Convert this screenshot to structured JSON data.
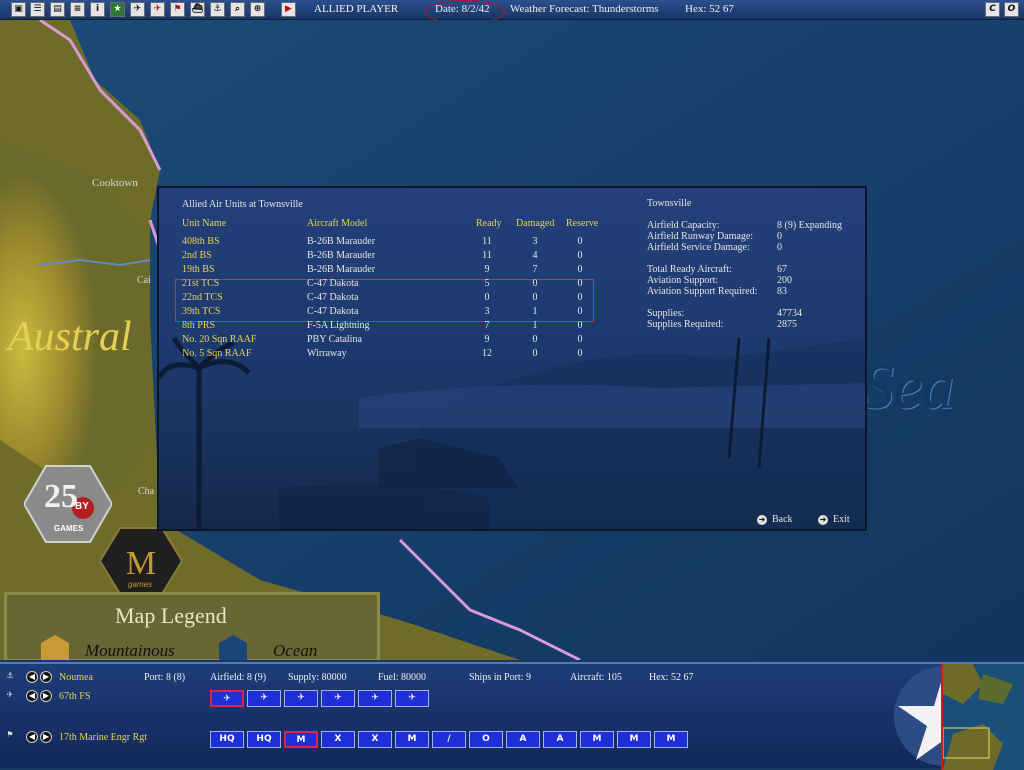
{
  "topbar": {
    "player": "ALLIED PLAYER",
    "date": "Date: 8/2/42",
    "weather": "Weather Forecast: Thunderstorms",
    "hex": "Hex: 52 67",
    "buttons": [
      "save-icon",
      "document-icon",
      "ledger-icon",
      "list-icon",
      "info-icon",
      "star-icon",
      "plane-group-icon",
      "plane-red-icon",
      "flag-icon",
      "ship-icon",
      "ships-icon",
      "magnifier-icon",
      "target-icon",
      "end-turn-icon"
    ],
    "right_buttons": [
      "C",
      "O"
    ]
  },
  "map": {
    "labels": {
      "cooktown": "Cooktown",
      "cairns": "Cai",
      "australia": "Austral",
      "sea": "Sea",
      "charters": "Cha"
    },
    "logos": {
      "by25": "BY",
      "by25_num": "25",
      "games": "GAMES",
      "matrix": "games"
    },
    "legend": {
      "title": "Map Legend",
      "mountainous": "Mountainous",
      "ocean": "Ocean"
    }
  },
  "panel": {
    "title": "Allied Air Units at Townsville",
    "headers": {
      "unit": "Unit Name",
      "model": "Aircraft Model",
      "ready": "Ready",
      "damaged": "Damaged",
      "reserve": "Reserve"
    },
    "rows": [
      {
        "unit": "408th BS",
        "model": "B-26B Marauder",
        "ready": "11",
        "damaged": "3",
        "reserve": "0"
      },
      {
        "unit": "2nd BS",
        "model": "B-26B Marauder",
        "ready": "11",
        "damaged": "4",
        "reserve": "0"
      },
      {
        "unit": "19th BS",
        "model": "B-26B Marauder",
        "ready": "9",
        "damaged": "7",
        "reserve": "0"
      },
      {
        "unit": "21st TCS",
        "model": "C-47 Dakota",
        "ready": "5",
        "damaged": "0",
        "reserve": "0"
      },
      {
        "unit": "22nd TCS",
        "model": "C-47 Dakota",
        "ready": "0",
        "damaged": "0",
        "reserve": "0"
      },
      {
        "unit": "39th TCS",
        "model": "C-47 Dakota",
        "ready": "3",
        "damaged": "1",
        "reserve": "0"
      },
      {
        "unit": "8th PRS",
        "model": "F-5A Lightning",
        "ready": "7",
        "damaged": "1",
        "reserve": "0"
      },
      {
        "unit": "No. 20 Sqn RAAF",
        "model": "PBY Catalina",
        "ready": "9",
        "damaged": "0",
        "reserve": "0"
      },
      {
        "unit": "No. 5 Sqn RAAF",
        "model": "Wirraway",
        "ready": "12",
        "damaged": "0",
        "reserve": "0"
      }
    ],
    "base": {
      "name": "Townsville",
      "stats": [
        {
          "label": "Airfield Capacity:",
          "value": "8 (9) Expanding"
        },
        {
          "label": "Airfield Runway Damage:",
          "value": "0"
        },
        {
          "label": "Airfield Service Damage:",
          "value": "0"
        },
        {
          "label": "Total Ready Aircraft:",
          "value": "67"
        },
        {
          "label": "Aviation Support:",
          "value": "200"
        },
        {
          "label": "Aviation Support Required:",
          "value": "83"
        },
        {
          "label": "Supplies:",
          "value": "47734"
        },
        {
          "label": "Supplies Required:",
          "value": "2875"
        }
      ]
    },
    "back_label": "Back",
    "exit_label": "Exit"
  },
  "bottom": {
    "base_name": "Noumea",
    "port": "Port: 8 (8)",
    "airfield": "Airfield: 8 (9)",
    "supply": "Supply: 80000",
    "fuel": "Fuel: 80000",
    "ships": "Ships in Port: 9",
    "aircraft": "Aircraft: 105",
    "hex": "Hex: 52 67",
    "air_unit": "67th FS",
    "ground_unit": "17th Marine Engr Rgt",
    "air_buttons": [
      "fighter-icon",
      "bomber-icon",
      "heavy-bomber-icon",
      "four-engine-bomber-icon",
      "patrol-plane-icon",
      "transport-plane-icon"
    ],
    "ground_buttons": [
      "HQ",
      "HQ",
      "M",
      "X",
      "X",
      "M",
      "/",
      "O",
      "A",
      "A",
      "M",
      "M",
      "M"
    ]
  },
  "colors": {
    "accent_yellow": "#e7d35a",
    "selection_red": "#d0303a",
    "unit_button_blue": "#1f2fd8"
  }
}
